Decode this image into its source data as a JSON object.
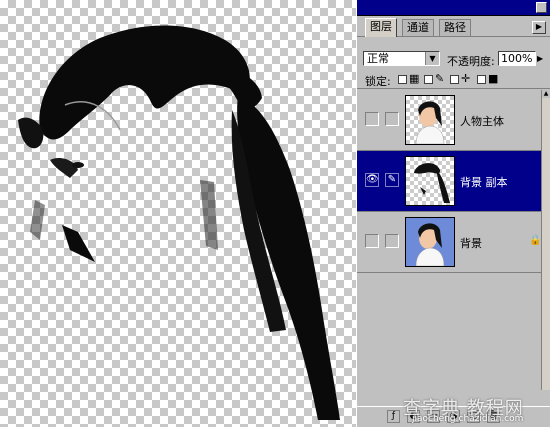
{
  "palette": {
    "tabs": [
      "图层",
      "通道",
      "路径"
    ],
    "blend_mode": "正常",
    "opacity_label": "不透明度:",
    "opacity_value": "100%",
    "lock_label": "锁定:"
  },
  "layers": [
    {
      "name": "人物主体",
      "visible": false,
      "selected": false,
      "locked": false
    },
    {
      "name": "背景 副本",
      "visible": true,
      "selected": true,
      "locked": false
    },
    {
      "name": "背景",
      "visible": false,
      "selected": false,
      "locked": true
    }
  ],
  "watermark": {
    "text": "查字典 教程网",
    "url": "jiaocheng.chazidian.com"
  },
  "colors": {
    "selection": "#00008a",
    "panel": "#c0c0c0"
  }
}
